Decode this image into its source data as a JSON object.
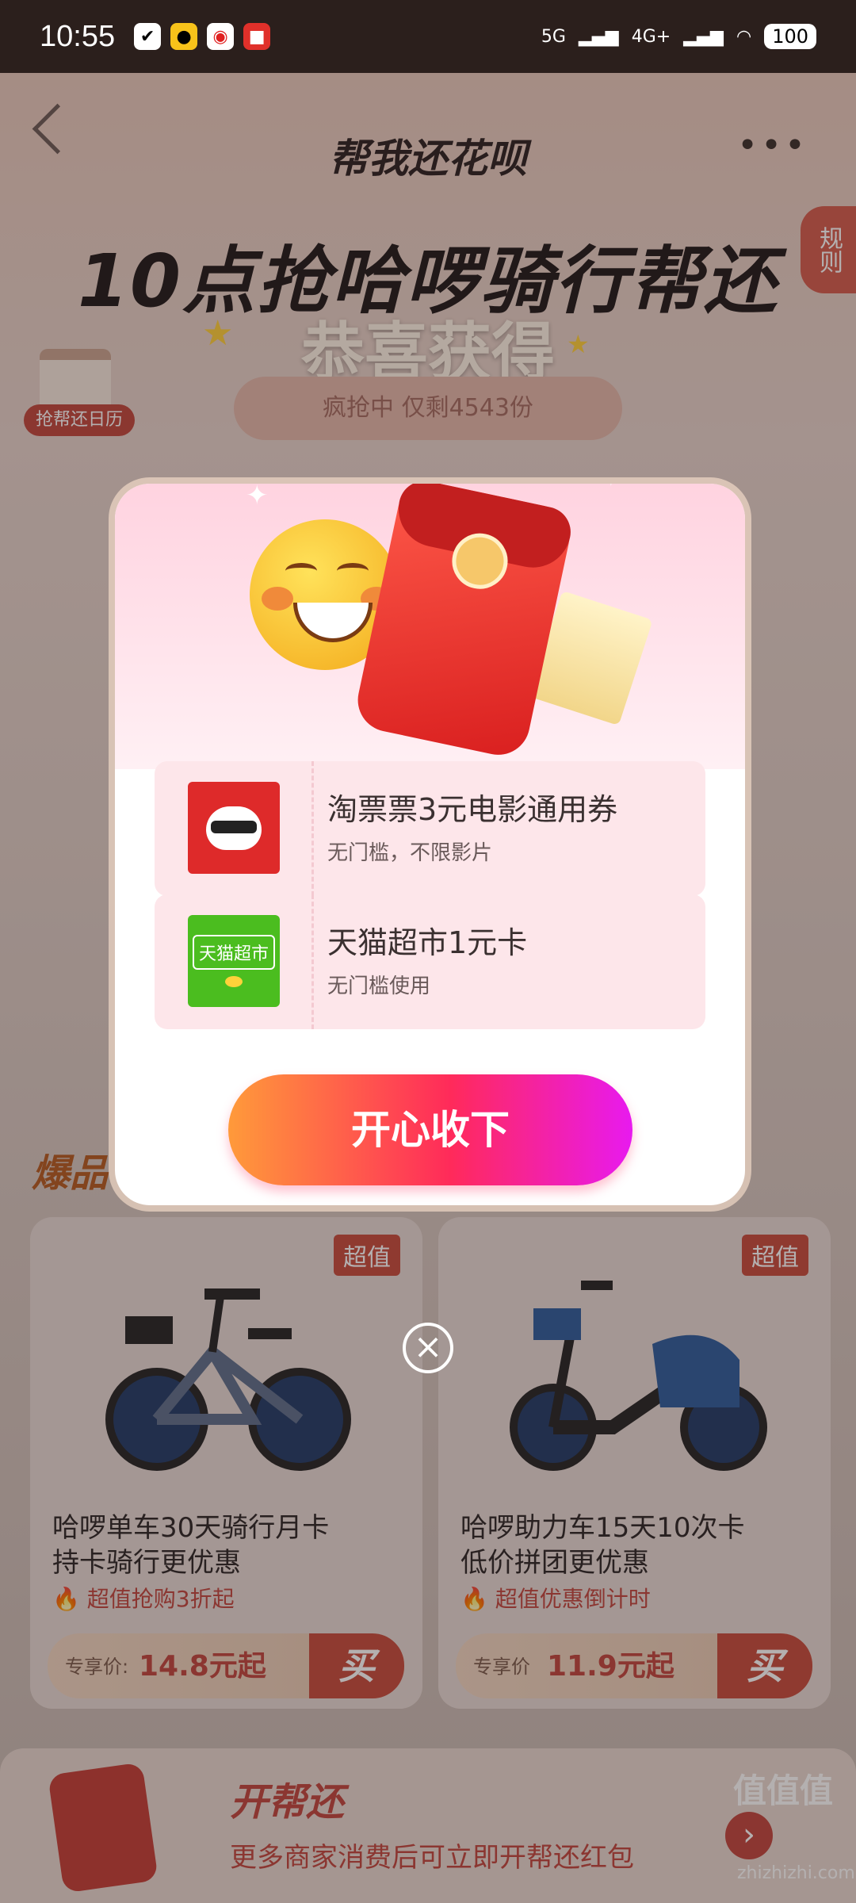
{
  "status": {
    "time": "10:55",
    "network_5g": "5G",
    "network_4g": "4G+",
    "battery": "100"
  },
  "header": {
    "title": "帮我还花呗",
    "rules_label": "规则"
  },
  "hero": {
    "headline": "10点抢哈啰骑行帮还",
    "congrats": "恭喜获得",
    "calendar_label": "抢帮还日历",
    "stock_text": "疯抢中 仅剩4543份"
  },
  "modal": {
    "coupons": [
      {
        "title": "淘票票3元电影通用券",
        "subtitle": "无门槛，不限影片",
        "logo": "taopiaopiao-icon"
      },
      {
        "title": "天猫超市1元卡",
        "subtitle": "无门槛使用",
        "logo_text": "天猫超市",
        "logo": "tmall-supermarket-icon"
      }
    ],
    "accept_label": "开心收下"
  },
  "section": {
    "title": "爆品"
  },
  "products": [
    {
      "badge": "超值",
      "name_line1": "哈啰单车30天骑行月卡",
      "name_line2": "持卡骑行更优惠",
      "tag": "超值抢购3折起",
      "price_label": "专享价:",
      "price": "14.8元起",
      "buy": "买"
    },
    {
      "badge": "超值",
      "name_line1": "哈啰助力车15天10次卡",
      "name_line2": "低价拼团更优惠",
      "tag": "超值优惠倒计时",
      "price_label": "专享价",
      "price": "11.9元起",
      "buy": "买"
    }
  ],
  "bottom_banner": {
    "title": "开帮还",
    "subtitle": "更多商家消费后可立即开帮还红包"
  },
  "watermark": {
    "text": "值值值",
    "url": "zhizhizhi.com"
  },
  "colors": {
    "accent_red": "#c0443c",
    "button_gradient_start": "#ff9a3a",
    "button_gradient_end": "#e81aef"
  }
}
